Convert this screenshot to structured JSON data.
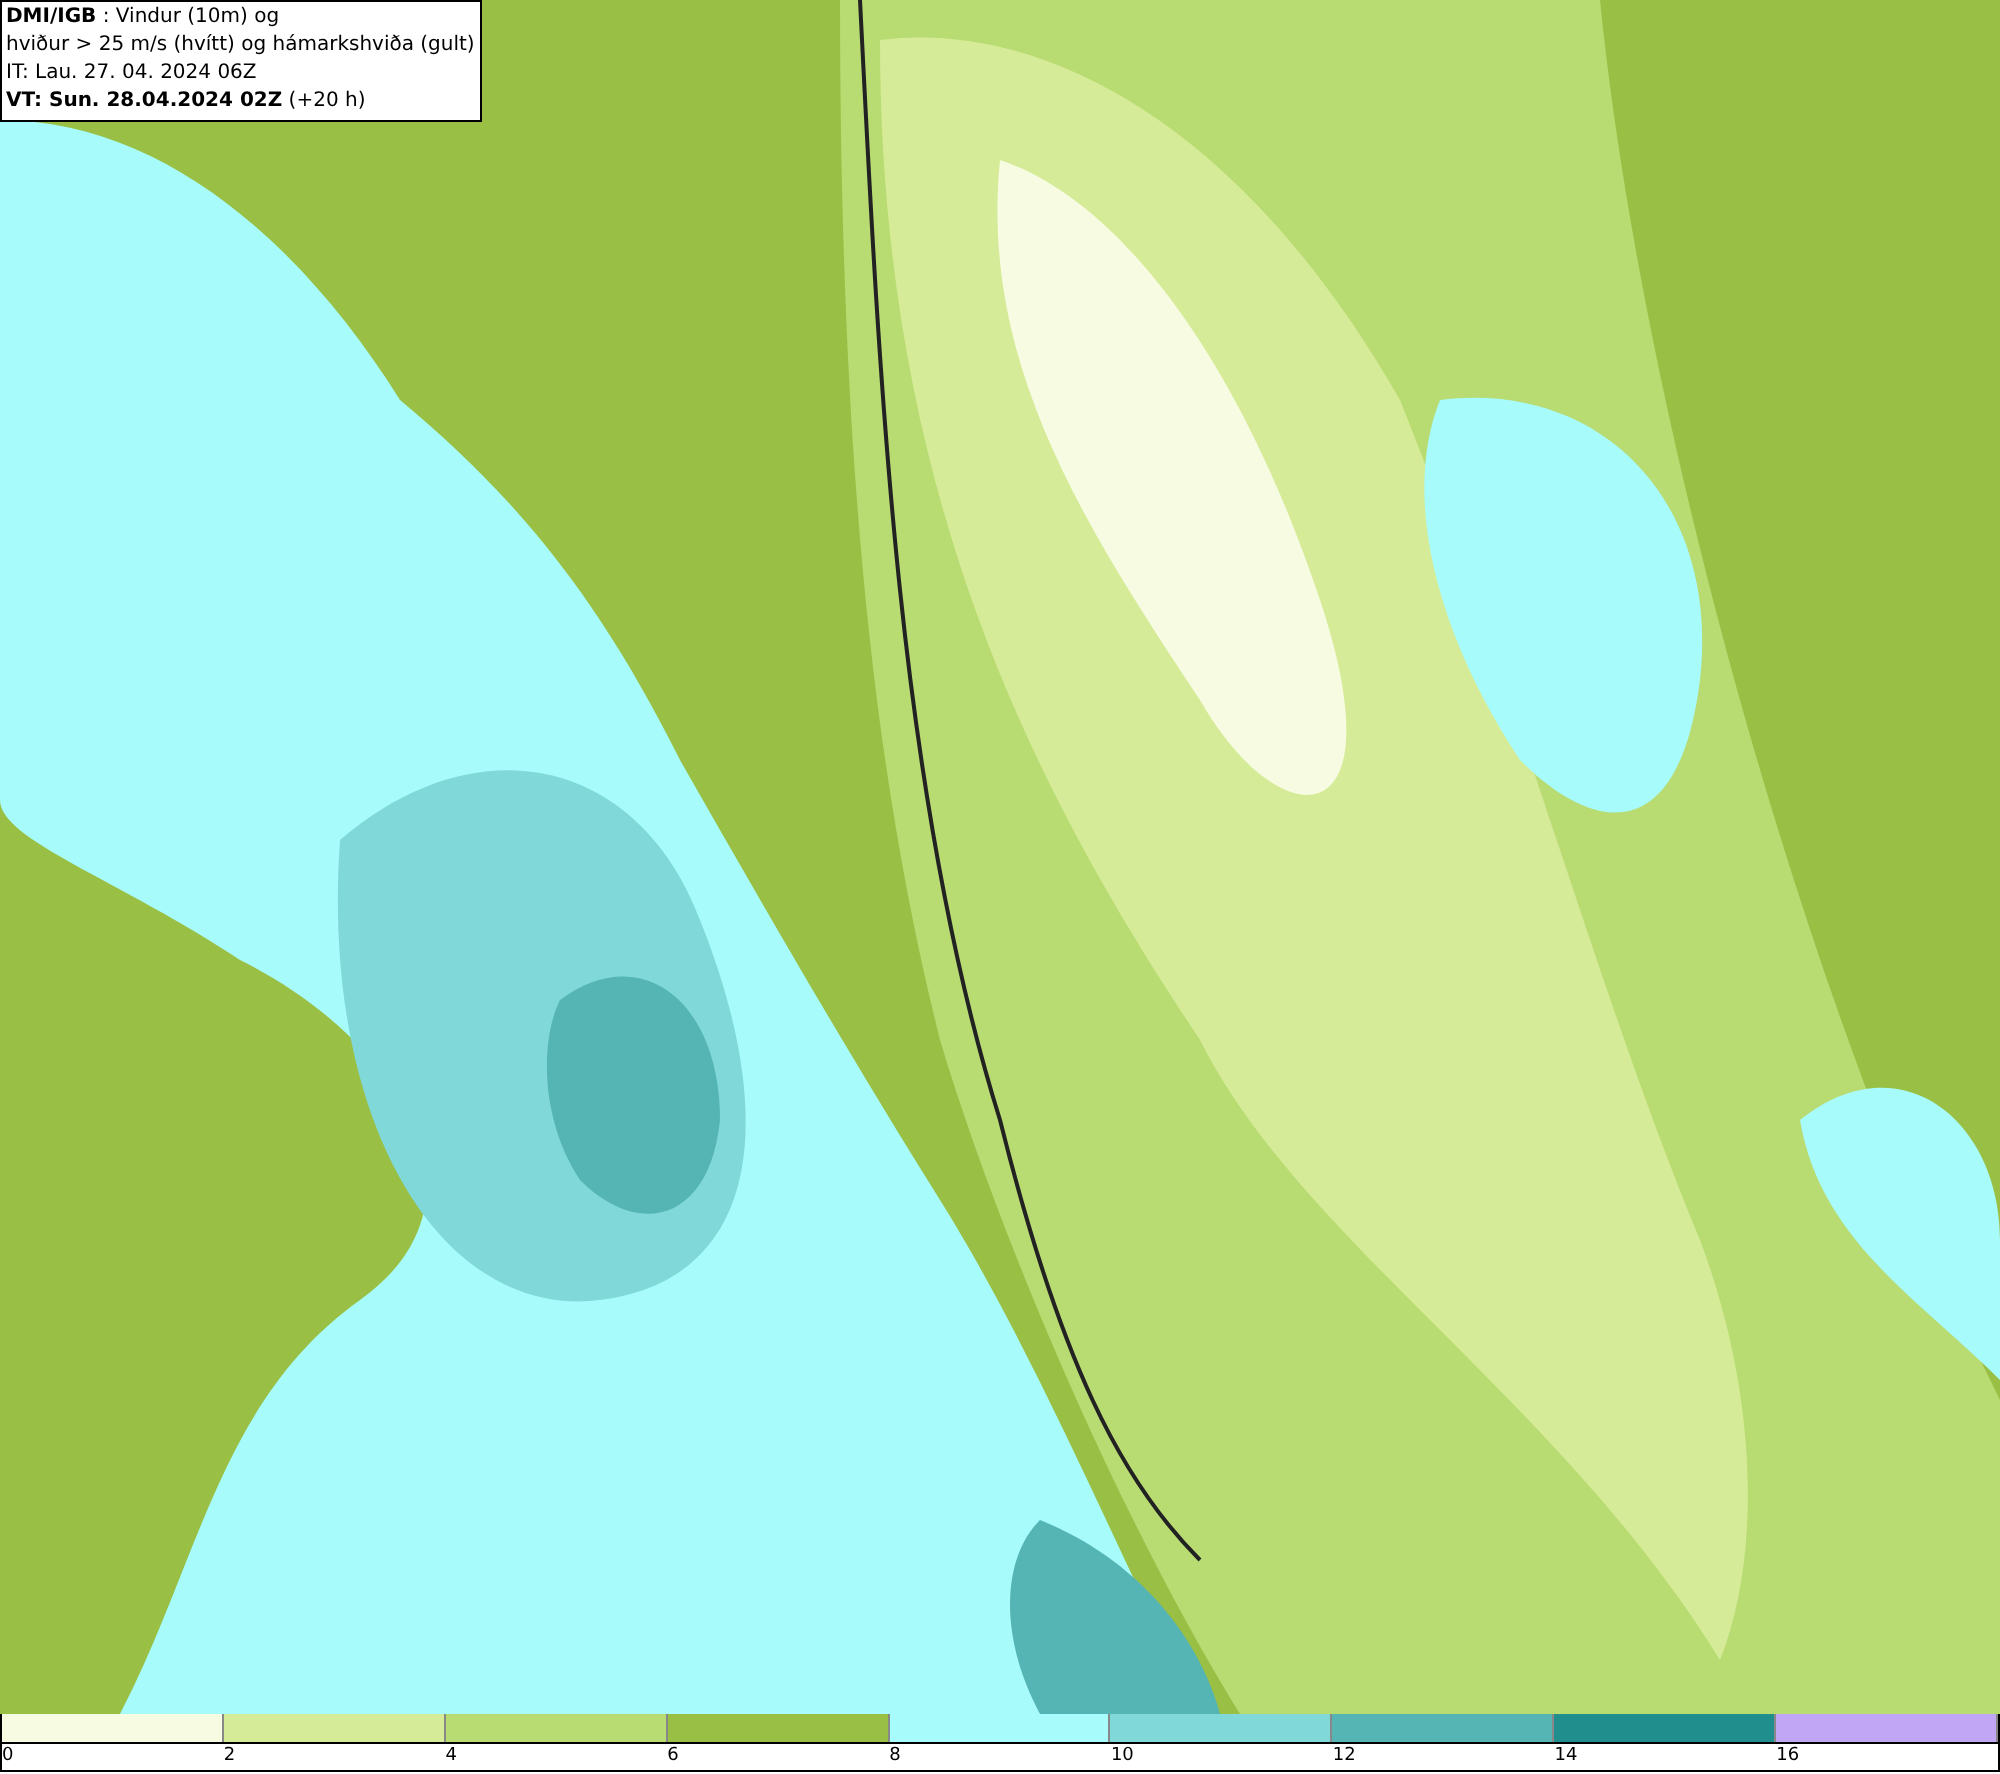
{
  "title_box": {
    "lines": [
      "**DMI/IGB** : Vindur (10m) og",
      "hviður > 25 m/s (hvítt) og hámarkshviða (gult)",
      "IT: Lau. 27. 04. 2024 06Z",
      "**VT: Sun. 28.04.2024 02Z** (+20 h)"
    ]
  },
  "legend": {
    "classes": [
      {
        "color": "#f7fbe1",
        "label": "0"
      },
      {
        "color": "#d6eb97",
        "label": "2"
      },
      {
        "color": "#b8db72",
        "label": "4"
      },
      {
        "color": "#9abf45",
        "label": "6"
      },
      {
        "color": "#a8fbfb",
        "label": "8"
      },
      {
        "color": "#80d8d8",
        "label": "10"
      },
      {
        "color": "#55b4b4",
        "label": "12"
      },
      {
        "color": "#218e8e",
        "label": "14"
      },
      {
        "color": "#c0a6f5",
        "label": "16"
      }
    ]
  }
}
